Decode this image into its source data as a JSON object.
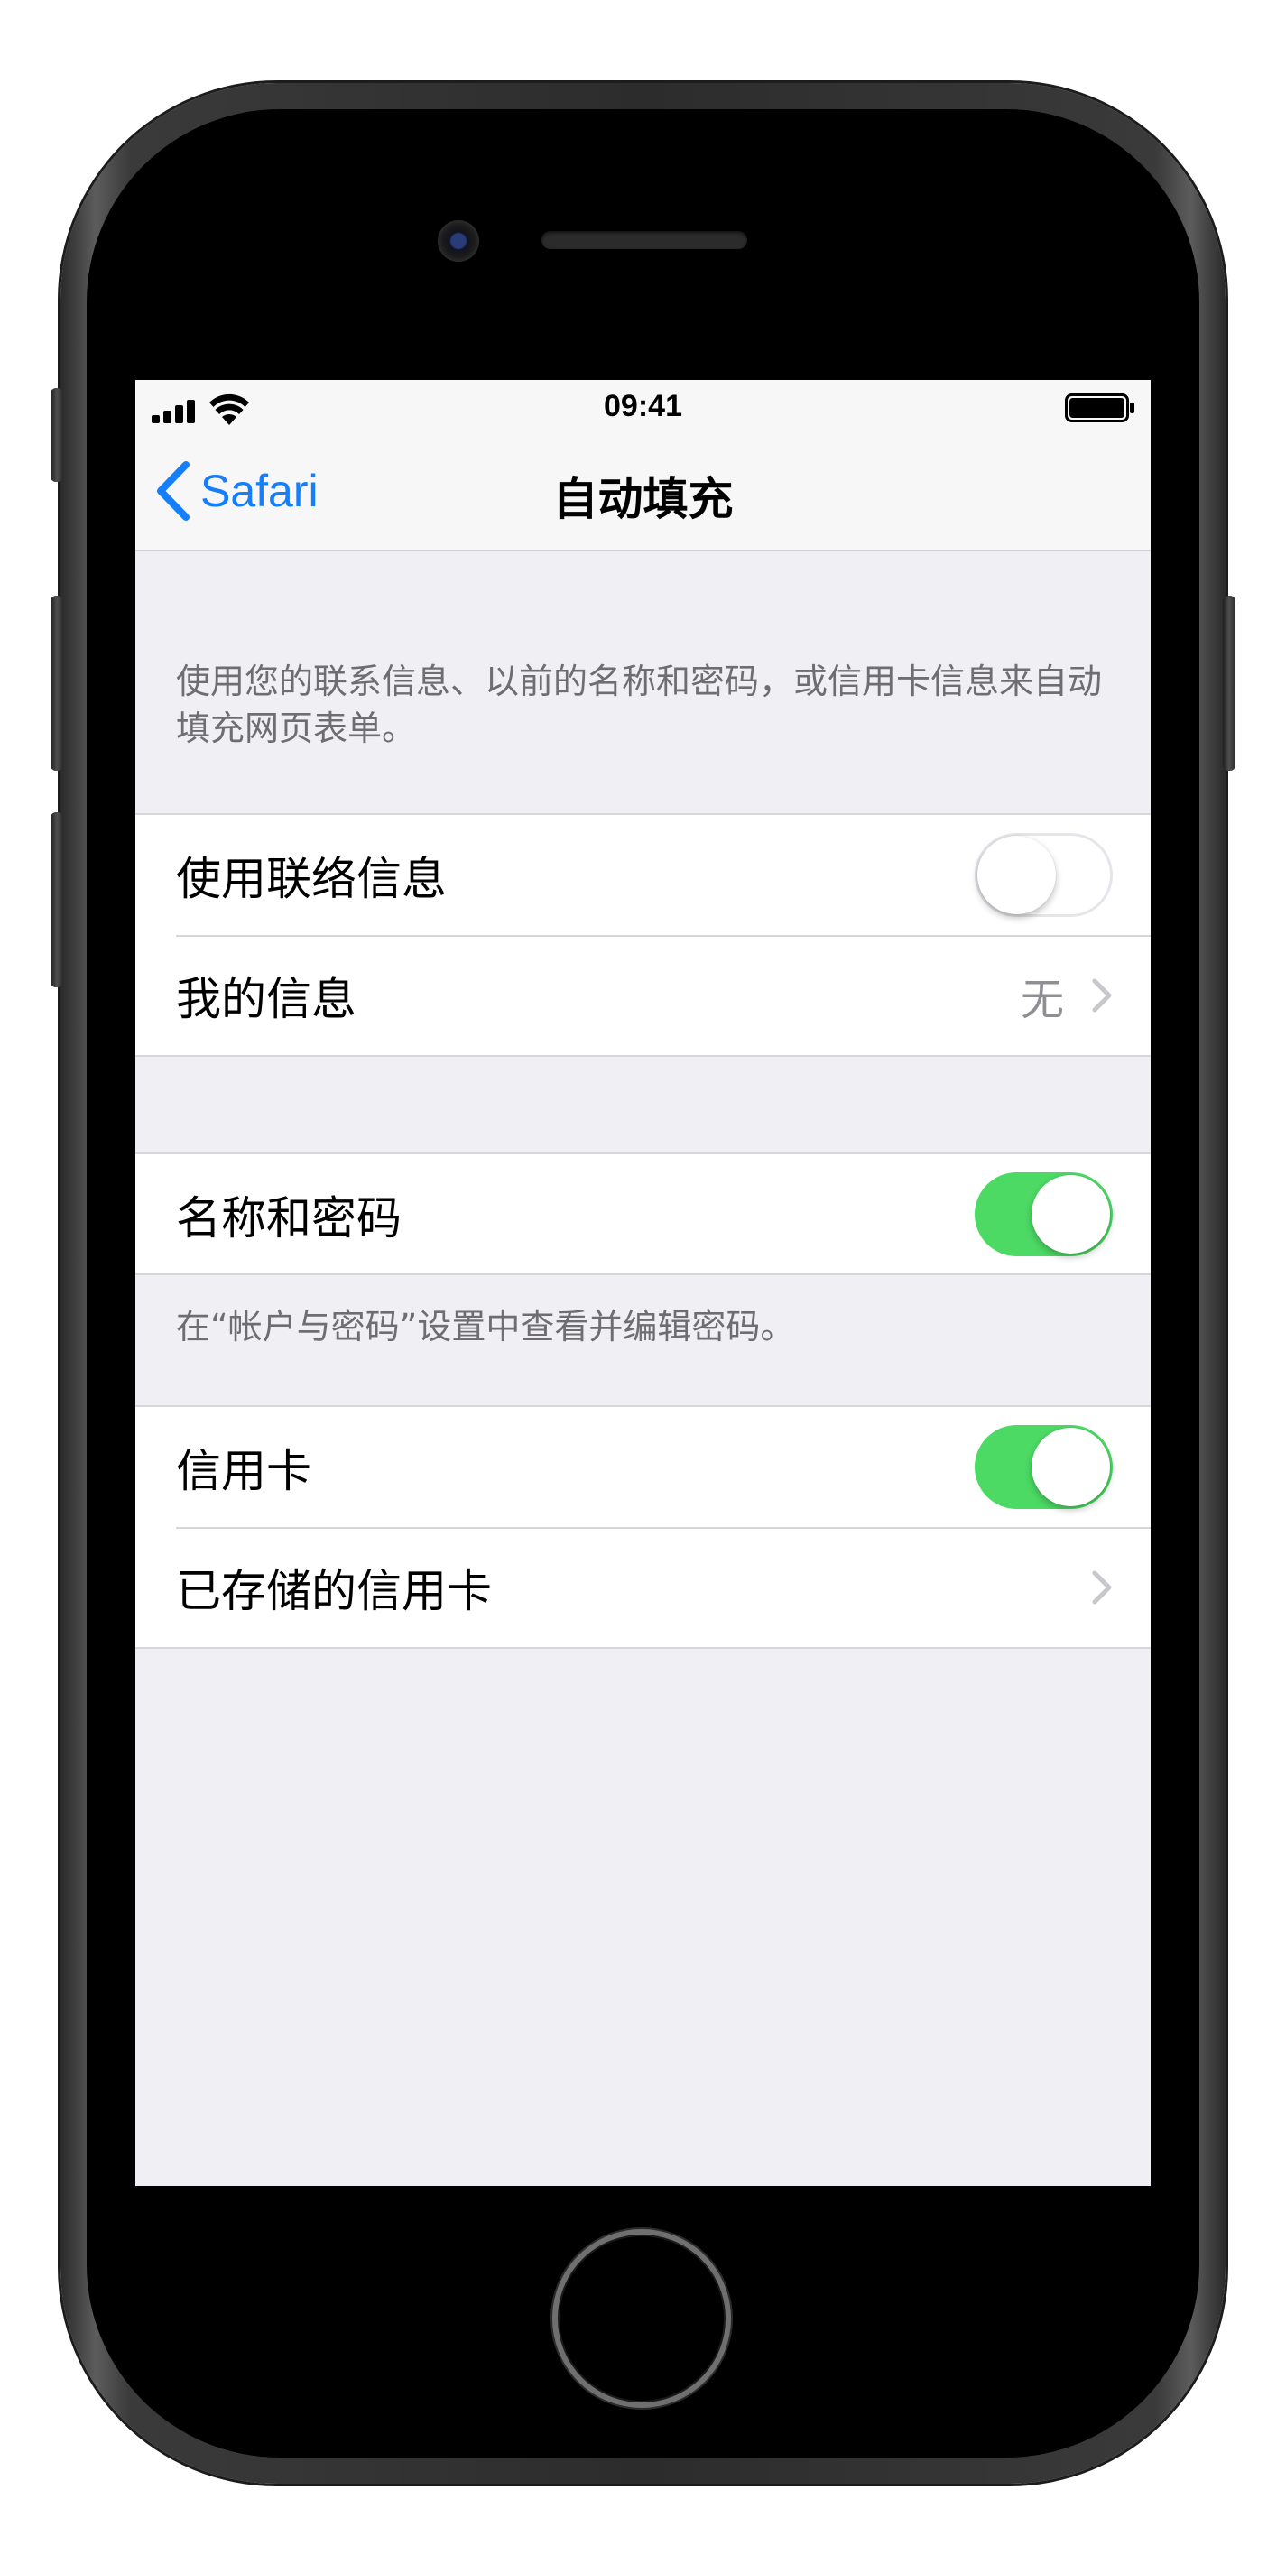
{
  "status_bar": {
    "time": "09:41"
  },
  "nav": {
    "back_label": "Safari",
    "title": "自动填充"
  },
  "description": "使用您的联系信息、以前的名称和密码，或信用卡信息来自动填充网页表单。",
  "groups": {
    "contact": {
      "use_contact_label": "使用联络信息",
      "use_contact_on": false,
      "my_info_label": "我的信息",
      "my_info_value": "无"
    },
    "passwords": {
      "label": "名称和密码",
      "on": true,
      "footer": "在“帐户与密码”设置中查看并编辑密码。"
    },
    "cards": {
      "credit_card_label": "信用卡",
      "credit_card_on": true,
      "saved_cards_label": "已存储的信用卡"
    }
  },
  "colors": {
    "accent": "#157efb",
    "toggle_on": "#4cd964",
    "background": "#efeff4"
  }
}
